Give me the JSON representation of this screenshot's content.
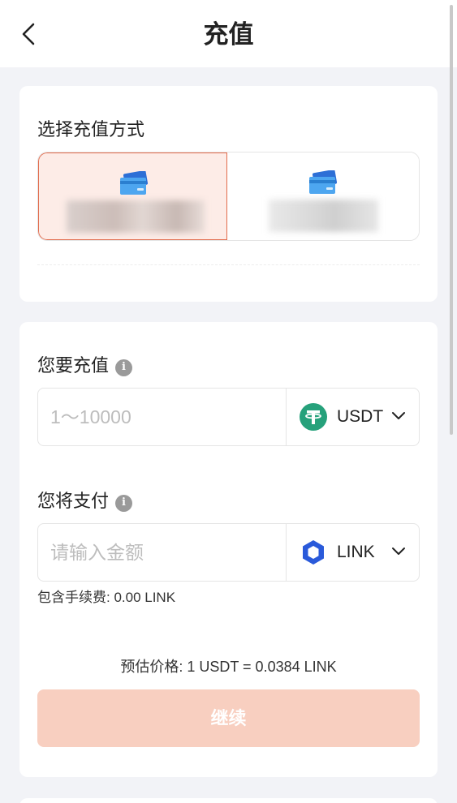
{
  "header": {
    "title": "充值",
    "back_icon": "chevron-left-icon"
  },
  "method_section": {
    "label": "选择充值方式",
    "methods": [
      {
        "icon": "bank-card-icon",
        "selected": true
      },
      {
        "icon": "bank-card-icon",
        "selected": false
      }
    ]
  },
  "amount_section": {
    "label": "您要充值",
    "info_icon": "i",
    "input_placeholder": "1～10000",
    "input_value": "",
    "currency": {
      "label": "USDT",
      "icon": "tether-icon",
      "color": "#26a17b"
    }
  },
  "pay_section": {
    "label": "您将支付",
    "info_icon": "i",
    "input_placeholder": "请输入金额",
    "input_value": "",
    "currency": {
      "label": "LINK",
      "icon": "chainlink-icon",
      "color": "#2a5ada"
    }
  },
  "fee_text": "包含手续费: 0.00 LINK",
  "rate_text": "预估价格: 1 USDT = 0.0384 LINK",
  "continue_label": "继续",
  "colors": {
    "accent": "#e26b4c",
    "button_disabled": "#f8cfc0",
    "background": "#f2f3f7"
  }
}
